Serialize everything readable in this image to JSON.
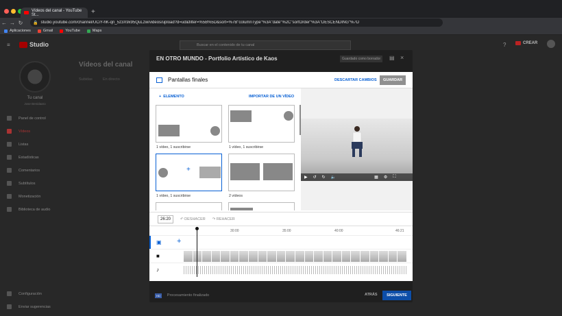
{
  "browser": {
    "tab_title": "Vídeos del canal - YouTube St...",
    "url": "studio.youtube.com/channel/UCiY-hK-qn_5z3X9x95QuLzw/videos/upload?d=ud&filter=%5B%5D&sort=%7B\"columnType\"%3A\"date\"%2C\"sortOrder\"%3A\"DESCENDING\"%7D",
    "bookmarks": [
      "Aplicaciones",
      "Gmail",
      "YouTube",
      "Maps"
    ]
  },
  "studio": {
    "logo": "Studio",
    "search_placeholder": "Buscar en el contenido de tu canal",
    "create": "CREAR",
    "channel_name": "Tu canal",
    "channel_sub": "Jose Benidaaro",
    "page_title": "Vídeos del canal",
    "tabs": [
      "Subidas",
      "En directo"
    ],
    "sidebar": [
      "Panel de control",
      "Vídeos",
      "Listas",
      "Estadísticas",
      "Comentarios",
      "Subtítulos",
      "Monetización",
      "Biblioteca de audio",
      "Configuración",
      "Enviar sugerencias"
    ]
  },
  "modal": {
    "title": "EN OTRO MUNDO - Portfolio Artístico de Kaos",
    "autosave": "Guardado como borrador",
    "panel_title": "Pantallas finales",
    "discard": "DESCARTAR CAMBIOS",
    "save": "GUARDAR",
    "add_element": "ELEMENTO",
    "import": "IMPORTAR DE UN VÍDEO",
    "templates": [
      "1 vídeo, 1 suscribirse",
      "1 vídeo, 1 suscribirse",
      "1 vídeo, 1 suscribirse",
      "2 vídeos"
    ],
    "time": "26:20",
    "undo": "DESHACER",
    "redo": "REHACER",
    "ticks": [
      "30:00",
      "35:00",
      "40:00",
      "46:21"
    ],
    "footer_status": "Procesamiento finalizado",
    "back": "ATRÁS",
    "next": "SIGUIENTE"
  }
}
